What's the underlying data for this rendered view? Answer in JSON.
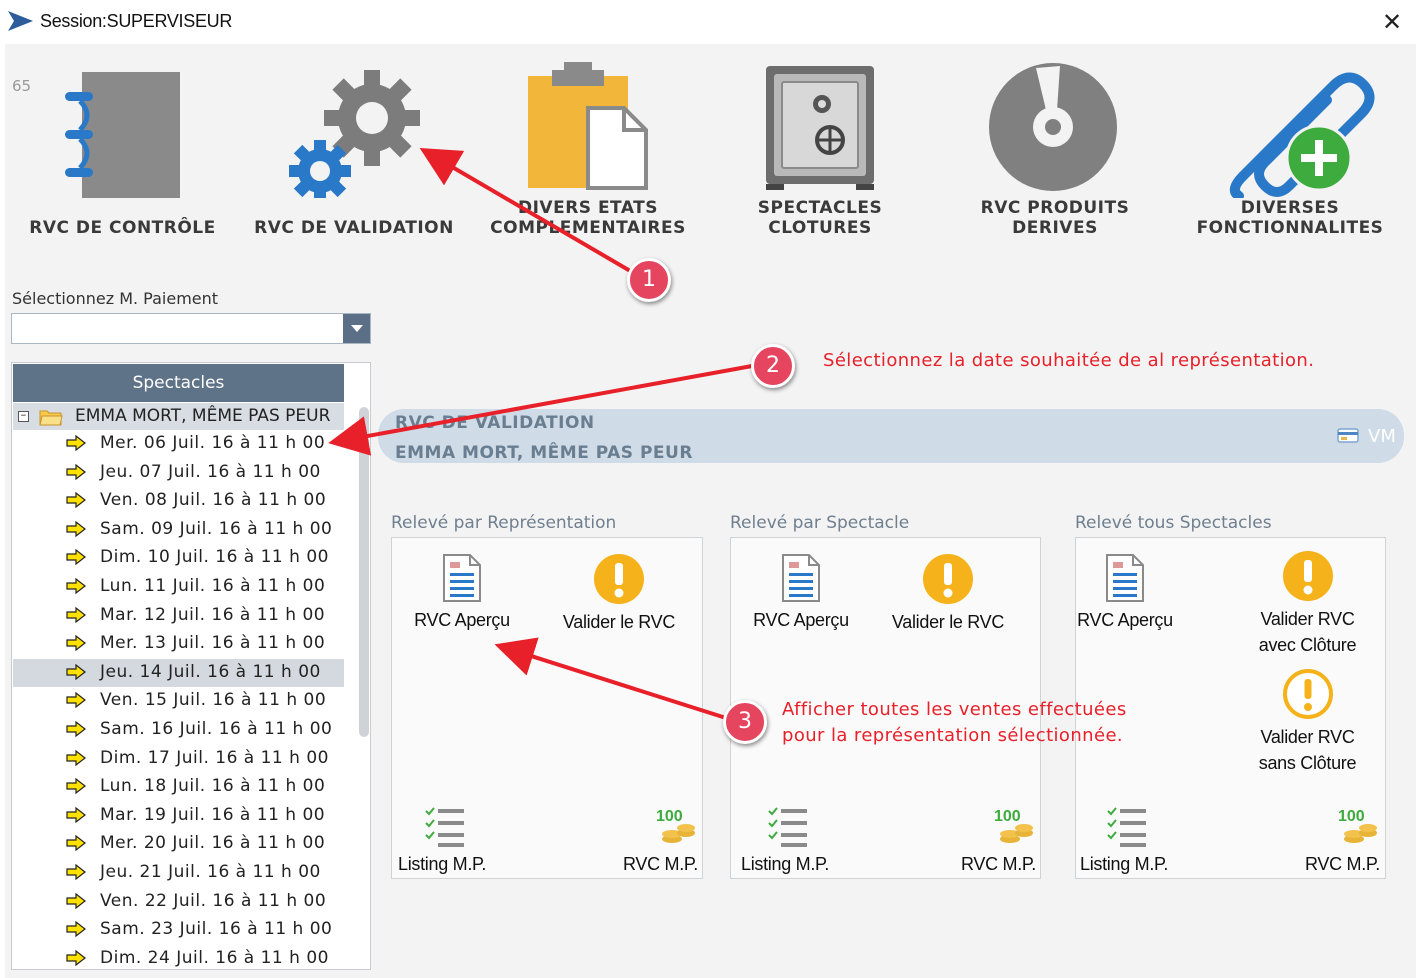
{
  "window": {
    "title": "Session:SUPERVISEUR",
    "close_label": "✕"
  },
  "counter": "65",
  "toolbar": {
    "items": [
      {
        "label_line1": "",
        "label_line2": "RVC DE CONTRÔLE",
        "icon": "notebook-icon"
      },
      {
        "label_line1": "",
        "label_line2": "RVC DE VALIDATION",
        "icon": "gears-icon"
      },
      {
        "label_line1": "DIVERS ETATS",
        "label_line2": "COMPLEMENTAIRES",
        "icon": "clipboard-icon"
      },
      {
        "label_line1": "SPECTACLES",
        "label_line2": "CLOTURES",
        "icon": "safe-icon"
      },
      {
        "label_line1": "RVC PRODUITS",
        "label_line2": "DERIVES",
        "icon": "disc-icon"
      },
      {
        "label_line1": "DIVERSES",
        "label_line2": "FONCTIONNALITES",
        "icon": "paperclip-plus-icon"
      }
    ]
  },
  "payment": {
    "label": "Sélectionnez M. Paiement",
    "value": ""
  },
  "tree": {
    "header": "Spectacles",
    "root_toggle": "−",
    "root_label": "EMMA MORT, MÊME PAS PEUR",
    "selected_index": 8,
    "dates": [
      "Mer. 06 Juil. 16  à 11 h 00",
      "Jeu. 07 Juil. 16  à 11 h 00",
      "Ven. 08 Juil. 16  à 11 h 00",
      "Sam. 09 Juil. 16  à 11 h 00",
      "Dim. 10 Juil. 16  à 11 h 00",
      "Lun. 11 Juil. 16  à 11 h 00",
      "Mar. 12 Juil. 16  à 11 h 00",
      "Mer. 13 Juil. 16  à 11 h 00",
      "Jeu. 14 Juil. 16  à 11 h 00",
      "Ven. 15 Juil. 16  à 11 h 00",
      "Sam. 16 Juil. 16  à 11 h 00",
      "Dim. 17 Juil. 16  à 11 h 00",
      "Lun. 18 Juil. 16  à 11 h 00",
      "Mar. 19 Juil. 16  à 11 h 00",
      "Mer. 20 Juil. 16  à 11 h 00",
      "Jeu. 21 Juil. 16  à 11 h 00",
      "Ven. 22 Juil. 16  à 11 h 00",
      "Sam. 23 Juil. 16  à 11 h 00",
      "Dim. 24 Juil. 16  à 11 h 00"
    ]
  },
  "band": {
    "title": "RVC DE VALIDATION",
    "subtitle": "EMMA MORT, MÊME PAS PEUR",
    "tag": "VM"
  },
  "sections": [
    {
      "title": "Relevé par Représentation",
      "preview": "RVC Aperçu",
      "validate": "Valider le RVC",
      "listing": "Listing M.P.",
      "rvc_mp": "RVC M.P."
    },
    {
      "title": "Relevé par Spectacle",
      "preview": "RVC Aperçu",
      "validate": "Valider le RVC",
      "listing": "Listing M.P.",
      "rvc_mp": "RVC M.P."
    },
    {
      "title": "Relevé tous Spectacles",
      "preview": "RVC Aperçu",
      "validate_close_1": "Valider RVC",
      "validate_close_2": "avec Clôture",
      "validate_noclose_1": "Valider RVC",
      "validate_noclose_2": "sans Clôture",
      "listing": "Listing M.P.",
      "rvc_mp": "RVC M.P."
    }
  ],
  "badge_number": "100",
  "annotations": [
    {
      "number": "1",
      "text": ""
    },
    {
      "number": "2",
      "text": "Sélectionnez la date souhaitée de al représentation."
    },
    {
      "number": "3",
      "text_line1": "Afficher toutes les ventes effectuées",
      "text_line2": "pour la représentation sélectionnée."
    }
  ],
  "colors": {
    "annotation_red": "#e8202a",
    "badge_pink": "#e5455e",
    "header_slate": "#5f7388",
    "band_blue": "#cfdbe6",
    "warn_yellow": "#f5b21b",
    "icon_blue": "#2a78c8"
  }
}
